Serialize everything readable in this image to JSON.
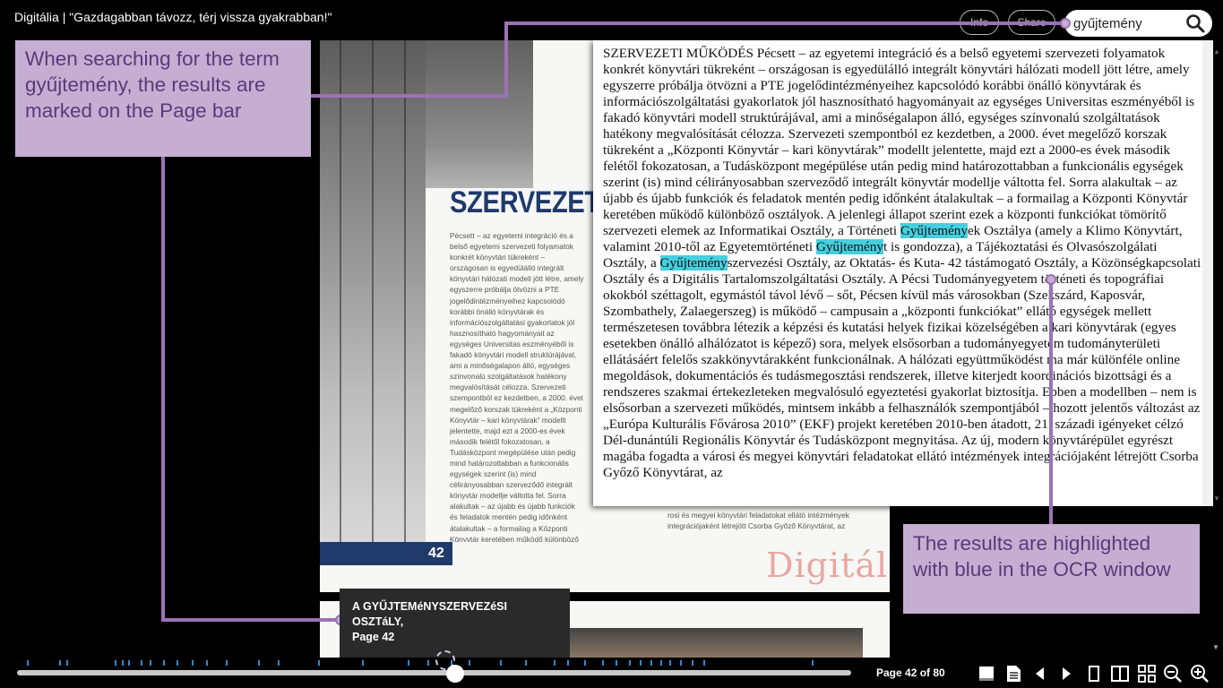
{
  "app": {
    "title": "Digitália | \"Gazdagabban távozz, térj vissza gyakrabban!\"",
    "info_label": "Info",
    "share_label": "Share"
  },
  "search": {
    "value": "gyűjtemény",
    "icon": "search-icon"
  },
  "page": {
    "heading": "SZERVEZET",
    "column_text": "Pécsett – az egyetemi integráció és a belső egyetemi szervezeti folyamatok konkrét könyvtári tükreként – országosan is egyedülálló integrált könyvtári hálózati modell jött létre, amely egyszerre próbálja ötvözni a PTE jogelődintézményeihez kapcsolódó korábbi önálló könyvtárak és információszolgáltatási gyakorlatok jól hasznosítható hagyományait az egységes Universitas eszményéből is fakadó könyvtári modell struktúrájával, ami a minőségalapon álló, egységes színvonalú szolgáltatások hatékony megvalósítását célozza. Szervezeti szempontból ez kezdetben, a 2000. évet megelőző korszak tükreként a „Központi Könyvtár – kari könyvtárak” modellt jelentette, majd ezt a 2000-es évek második felétől fokozatosan, a Tudásközpont megépülése után pedig mind határozottabban a funkcionális egységek szerint (is) mind célirányosabban szerveződő integrált könyvtár modellje váltotta fel. Sorra alakultak – az újabb és újabb funkciók és feladatok mentén pedig időnként átalakultak – a formailag a Központi Könyvtár keretében működő különböző osztályok. A jelenlegi állapot szerint ezek a központi funkciókat tömörítő szervezeti elemek az Informatikai Osztály, a Történeti Gyűjtemények Osztálya (amely a Klimo Könyvtárt, valamint 2010-től az Egyetemtörténeti Gyűjteményt is gondozza), a Tájékoztatási és Olvasószolgálati Osztály, a Gyűjteményszervezési Osztály, az Oktatás- és Kuta-",
    "column2_text": "rosi és megyei könyvtári feladatokat ellátó intézmények integrációjaként létrejött Csorba Győző Könyvtárat, az",
    "number": "42",
    "logo_text": "Digitália"
  },
  "ocr": {
    "segments": [
      {
        "text": "SZERVEZETI MŰKÖDÉS Pécsett – az egyetemi integráció és a belső egyetemi szervezeti folyamatok konkrét könyvtári tükreként – országosan is egyedülálló integrált könyvtári hálózati modell jött létre, amely egyszerre próbálja ötvözni a PTE jogelődintézményeihez kapcsolódó korábbi önálló könyvtárak és információszolgáltatási gyakorlatok jól hasznosítható hagyományait az egységes Universitas eszményéből is fakadó könyvtári modell struktúrájával, ami a minőségalapon álló, egységes színvonalú szolgáltatások hatékony megvalósítását célozza. Szervezeti szempontból ez kezdetben, a 2000. évet megelőző korszak tükreként a „Központi Könyvtár – kari könyvtárak” modellt jelentette, majd ezt a 2000-es évek második felétől fokozatosan, a Tudásközpont megépülése után pedig mind határozottabban a funkcionális egységek szerint (is) mind célirányosabban szerveződő integrált könyvtár modellje váltotta fel. Sorra alakultak – az újabb és újabb funkciók és feladatok mentén pedig időnként átalakultak – a formailag a Központi Könyvtár keretében működő különböző osztályok. A jelenlegi állapot szerint ezek a központi funkciókat tömörítő szervezeti elemek az Informatikai Osztály, a Történeti ",
        "highlight": false
      },
      {
        "text": "Gyűjtemény",
        "highlight": true
      },
      {
        "text": "ek Osztálya (amely a Klimo Könyvtárt, valamint 2010-től az Egyetemtörténeti ",
        "highlight": false
      },
      {
        "text": "Gyűjtemény",
        "highlight": true
      },
      {
        "text": "t is gondozza), a Tájékoztatási és Olvasószolgálati Osztály, a ",
        "highlight": false
      },
      {
        "text": "Gyűjtemény",
        "highlight": true
      },
      {
        "text": "szervezési Osztály, az Oktatás- és Kuta- 42 tástámogató Osztály, a Közönségkapcsolati Osztály és a Digitális Tartalomszolgáltatási Osztály. A Pécsi Tudományegyetem történeti és topográfiai okokból széttagolt, egymástól távol lévő – sőt, Pécsen kívül más városokban (Szekszárd, Kaposvár, Szombathely, Zalaegerszeg) is működő – campusain a „központi funkciókat” ellátó egységek mellett természetesen továbbra létezik a képzési és kutatási helyek fizikai közelségében a kari könyvtárak (egyes esetekben önálló alhálózatot is képező) sora, melyek elsősorban a tudományegyetem tudományterületi ellátásáért felelős szakkönyvtárakként funkcionálnak. A hálózati együttműködést ma már különféle online megoldások, dokumentációs és tudásmegosztási rendszerek, illetve kiterjedt koordinációs bizottsági és a rendszeres szakmai értekezleteken megvalósuló egyeztetési gyakorlat biztosítja. Ebben a modellben – nem is elsősorban a szervezeti működés, mintsem inkább a felhasználók szempontjából – hozott jelentős változást az „Európa Kulturális Fővárosa 2010” (EKF) projekt keretében 2010-ben átadott, 21. századi igényeket célzó Dél-dunántúli Regionális Könyvtár és Tudásközpont megnyitása. Az új, modern könyvtárépület egyrészt magába fogadta a városi és megyei könyvtári feladatokat ellátó intézmények integrációjaként létrejött Csorba Győző Könyvtárat, az",
        "highlight": false
      }
    ]
  },
  "callouts": {
    "search": "When searching for the term gyűjtemény, the results are marked on the Page bar",
    "ocr": "The results are highlighted with blue in the OCR window"
  },
  "tooltip": {
    "title": "A GYŰJTEMéNYSZERVEZéSI OSZTáLY,",
    "page": "Page 42"
  },
  "navigation": {
    "page_indicator": "Page 42 of 80",
    "current_page": 42,
    "total_pages": 80,
    "slider_position": 0.525,
    "result_ticks": [
      0.012,
      0.051,
      0.059,
      0.117,
      0.126,
      0.133,
      0.148,
      0.159,
      0.175,
      0.191,
      0.209,
      0.227,
      0.25,
      0.289,
      0.313,
      0.361,
      0.414,
      0.468,
      0.492,
      0.52,
      0.541,
      0.579,
      0.609,
      0.643,
      0.66,
      0.68,
      0.701,
      0.717,
      0.734,
      0.746,
      0.759,
      0.771,
      0.782,
      0.795,
      0.809,
      0.823,
      0.953
    ],
    "toolbar_icons": [
      "book-icon",
      "document-icon",
      "previous-icon",
      "next-icon",
      "single-page-icon",
      "double-page-icon",
      "grid-icon",
      "zoom-out-icon",
      "zoom-in-icon"
    ]
  },
  "colors": {
    "highlight": "#45cfe0",
    "callout_bg": "#c5aed2",
    "callout_text": "#5a3a7a",
    "connector": "#9b72b6",
    "tick": "#2e8bd6"
  }
}
